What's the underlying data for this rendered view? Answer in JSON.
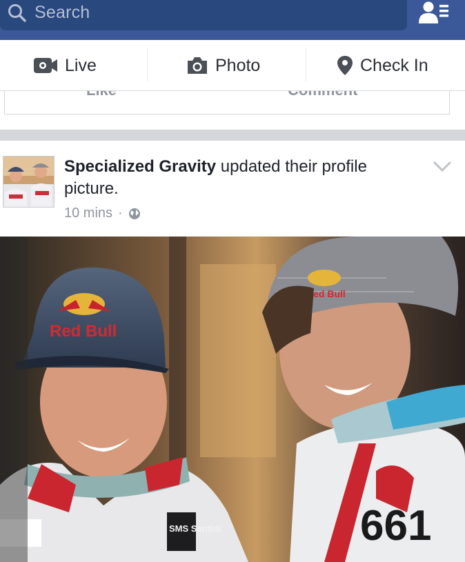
{
  "header": {
    "search_placeholder": "Search",
    "search_icon": "search-icon",
    "friends_icon": "friend-requests-icon",
    "bar_color": "#3b5998"
  },
  "composer": {
    "actions": [
      {
        "label": "Live",
        "icon": "video-camera-icon"
      },
      {
        "label": "Photo",
        "icon": "camera-icon"
      },
      {
        "label": "Check In",
        "icon": "location-pin-icon"
      }
    ]
  },
  "previous_post": {
    "like_label": "Like",
    "comment_label": "Comment"
  },
  "post": {
    "author": "Specialized Gravity",
    "action_text": " updated their profile picture.",
    "timestamp": "10 mins",
    "separator": "·",
    "privacy_icon": "globe-icon",
    "menu_icon": "chevron-down-icon",
    "photo": {
      "cap_logo": "Red Bull",
      "cap_logo_small": "Red Bull",
      "jersey_number": "661",
      "jersey_brand": "SMS Santini"
    }
  }
}
